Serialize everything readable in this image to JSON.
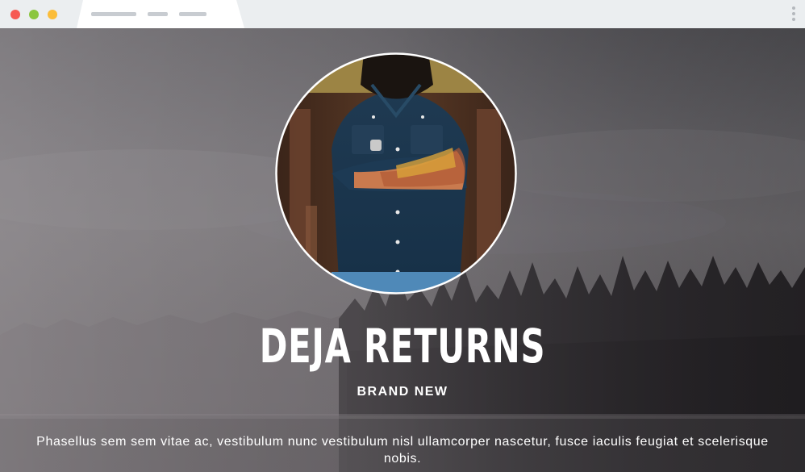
{
  "colors": {
    "close_dot": "#f65a53",
    "minimize_dot": "#8cc63f",
    "maximize_dot": "#fbbd3a",
    "chrome_bg": "#ebeef0",
    "tab_bg": "#ffffff",
    "hero_text": "#ffffff"
  },
  "hero": {
    "title": "DEJA RETURNS",
    "subtitle": "BRAND NEW",
    "body": "Phasellus sem sem vitae ac, vestibulum nunc vestibulum nisl ullamcorper nascetur, fusce iaculis feugiat et scelerisque nobis."
  }
}
